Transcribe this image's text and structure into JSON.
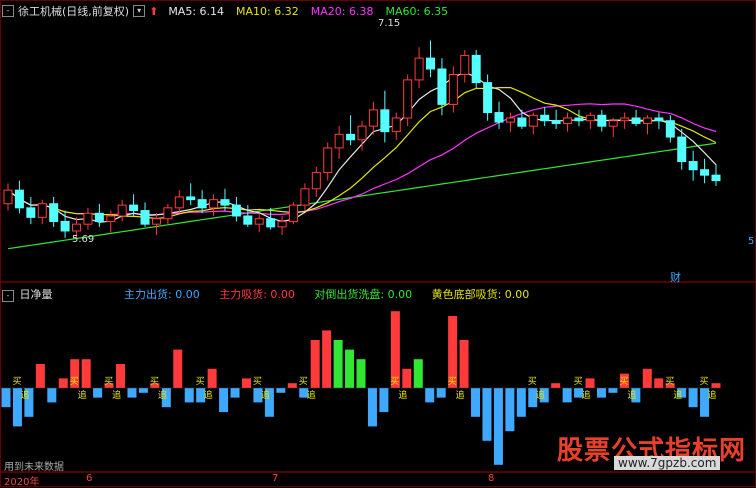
{
  "header": {
    "title": "徐工机械(日线,前复权)",
    "ma5": "MA5: 6.14",
    "ma10": "MA10: 6.32",
    "ma20": "MA20: 6.38",
    "ma60": "MA60: 6.35"
  },
  "annotations": {
    "high": "7.15",
    "low": "5.69",
    "cai": "财",
    "right_digit": "5"
  },
  "sub_header": {
    "title": "日净量",
    "zhuli_chuhuo": "主力出货: 0.00",
    "zhuli_xihuo": "主力吸货: 0.00",
    "duichong": "对倒出货洗盘: 0.00",
    "huangse": "黄色底部吸货: 0.00"
  },
  "footer": {
    "future_data": "用到未来数据",
    "year": "2020年",
    "m6": "6",
    "m7": "7",
    "m8": "8"
  },
  "watermark": {
    "main": "股票公式指标网",
    "site": "www.7gpzb.com"
  },
  "sub_markers": {
    "buy": "买",
    "chase": "追"
  },
  "colors": {
    "up": "#ff3a3a",
    "down": "#54ffff",
    "ma5": "#e6e6e6",
    "ma10": "#e6e600",
    "ma20": "#ff33ff",
    "ma60": "#33e633",
    "vol_down": "#3fa9ff",
    "vol_green": "#33e633"
  },
  "chart_data": [
    {
      "type": "candlestick",
      "title": "徐工机械(日线,前复权)",
      "ohlc": [
        [
          5.95,
          6.1,
          5.9,
          6.05
        ],
        [
          6.05,
          6.12,
          5.88,
          5.92
        ],
        [
          5.92,
          6.0,
          5.8,
          5.85
        ],
        [
          5.85,
          5.98,
          5.8,
          5.95
        ],
        [
          5.95,
          6.0,
          5.78,
          5.82
        ],
        [
          5.82,
          5.9,
          5.7,
          5.75
        ],
        [
          5.75,
          5.85,
          5.69,
          5.8
        ],
        [
          5.8,
          5.92,
          5.76,
          5.88
        ],
        [
          5.88,
          5.95,
          5.78,
          5.82
        ],
        [
          5.82,
          5.9,
          5.74,
          5.86
        ],
        [
          5.86,
          5.98,
          5.82,
          5.94
        ],
        [
          5.94,
          6.02,
          5.86,
          5.9
        ],
        [
          5.9,
          5.96,
          5.78,
          5.8
        ],
        [
          5.8,
          5.88,
          5.72,
          5.84
        ],
        [
          5.84,
          5.95,
          5.8,
          5.92
        ],
        [
          5.92,
          6.05,
          5.88,
          6.0
        ],
        [
          6.0,
          6.1,
          5.94,
          5.98
        ],
        [
          5.98,
          6.05,
          5.88,
          5.92
        ],
        [
          5.92,
          6.02,
          5.86,
          5.98
        ],
        [
          5.98,
          6.06,
          5.9,
          5.94
        ],
        [
          5.94,
          6.0,
          5.82,
          5.86
        ],
        [
          5.86,
          5.94,
          5.78,
          5.8
        ],
        [
          5.8,
          5.88,
          5.74,
          5.84
        ],
        [
          5.84,
          5.92,
          5.76,
          5.78
        ],
        [
          5.78,
          5.86,
          5.72,
          5.82
        ],
        [
          5.82,
          5.96,
          5.8,
          5.94
        ],
        [
          5.94,
          6.1,
          5.9,
          6.06
        ],
        [
          6.06,
          6.22,
          6.0,
          6.18
        ],
        [
          6.18,
          6.4,
          6.12,
          6.36
        ],
        [
          6.36,
          6.52,
          6.28,
          6.46
        ],
        [
          6.46,
          6.6,
          6.38,
          6.42
        ],
        [
          6.42,
          6.56,
          6.34,
          6.52
        ],
        [
          6.52,
          6.7,
          6.46,
          6.64
        ],
        [
          6.64,
          6.78,
          6.4,
          6.48
        ],
        [
          6.48,
          6.62,
          6.42,
          6.58
        ],
        [
          6.58,
          6.9,
          6.52,
          6.86
        ],
        [
          6.86,
          7.1,
          6.8,
          7.02
        ],
        [
          7.02,
          7.15,
          6.88,
          6.94
        ],
        [
          6.94,
          7.02,
          6.6,
          6.68
        ],
        [
          6.68,
          6.96,
          6.62,
          6.9
        ],
        [
          6.9,
          7.08,
          6.84,
          7.04
        ],
        [
          7.04,
          7.08,
          6.8,
          6.84
        ],
        [
          6.84,
          6.9,
          6.56,
          6.62
        ],
        [
          6.62,
          6.7,
          6.5,
          6.55
        ],
        [
          6.55,
          6.62,
          6.48,
          6.58
        ],
        [
          6.58,
          6.64,
          6.5,
          6.52
        ],
        [
          6.52,
          6.62,
          6.46,
          6.6
        ],
        [
          6.6,
          6.66,
          6.52,
          6.56
        ],
        [
          6.56,
          6.64,
          6.5,
          6.54
        ],
        [
          6.54,
          6.62,
          6.48,
          6.58
        ],
        [
          6.58,
          6.64,
          6.52,
          6.56
        ],
        [
          6.56,
          6.62,
          6.5,
          6.6
        ],
        [
          6.6,
          6.64,
          6.48,
          6.52
        ],
        [
          6.52,
          6.58,
          6.44,
          6.56
        ],
        [
          6.56,
          6.62,
          6.5,
          6.58
        ],
        [
          6.58,
          6.64,
          6.52,
          6.54
        ],
        [
          6.54,
          6.6,
          6.46,
          6.58
        ],
        [
          6.58,
          6.62,
          6.5,
          6.56
        ],
        [
          6.56,
          6.6,
          6.4,
          6.44
        ],
        [
          6.44,
          6.5,
          6.2,
          6.26
        ],
        [
          6.26,
          6.34,
          6.12,
          6.2
        ],
        [
          6.2,
          6.28,
          6.1,
          6.16
        ],
        [
          6.16,
          6.24,
          6.08,
          6.12
        ]
      ],
      "annotations": [
        "7.15",
        "5.69"
      ]
    },
    {
      "type": "bar",
      "title": "日净量",
      "values": [
        -0.4,
        -0.8,
        -0.6,
        0.5,
        -0.3,
        0.2,
        0.6,
        0.6,
        -0.2,
        0.1,
        0.5,
        -0.2,
        -0.1,
        0.1,
        -0.4,
        0.8,
        -0.3,
        -0.3,
        0.4,
        -0.5,
        -0.2,
        0.2,
        -0.3,
        -0.6,
        -0.1,
        0.1,
        -0.2,
        1.0,
        1.2,
        1.0,
        0.8,
        0.6,
        -0.8,
        -0.5,
        1.6,
        0.4,
        0.6,
        -0.3,
        -0.2,
        1.5,
        1.0,
        -0.6,
        -1.1,
        -1.6,
        -0.9,
        -0.6,
        -0.4,
        -0.3,
        0.1,
        -0.3,
        -0.2,
        0.2,
        -0.2,
        -0.1,
        0.3,
        -0.3,
        0.4,
        0.2,
        0.1,
        -0.2,
        -0.4,
        -0.6,
        0.1
      ]
    }
  ]
}
